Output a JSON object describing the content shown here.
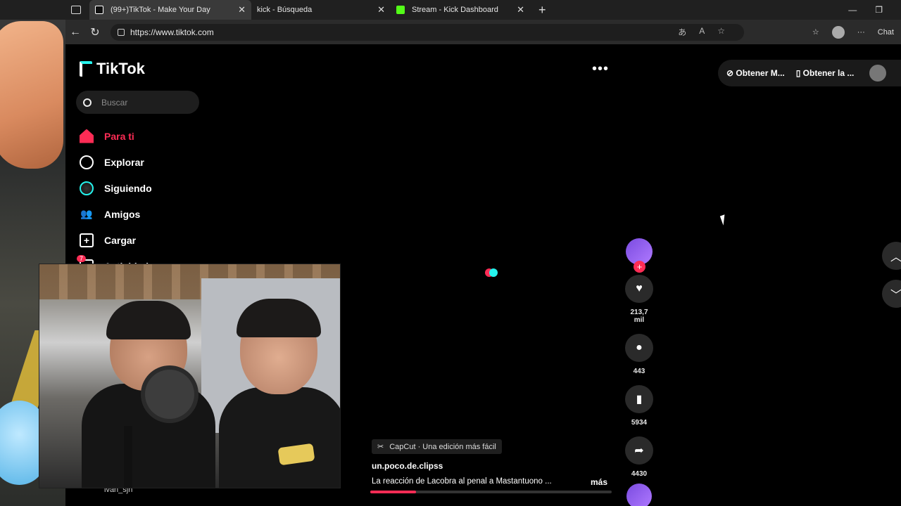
{
  "browser": {
    "tabs": [
      {
        "label": "(99+)TikTok - Make Your Day",
        "active": true,
        "favicon": "tiktok-icon"
      },
      {
        "label": "kick - Búsqueda",
        "active": false,
        "favicon": "search-icon"
      },
      {
        "label": "Stream - Kick Dashboard",
        "active": false,
        "favicon": "kick-icon"
      }
    ],
    "tab_close": "✕",
    "new_tab": "+",
    "url": "https://www.tiktok.com",
    "chat_label": "Chat",
    "minimize": "—",
    "restore": "❐"
  },
  "tiktok": {
    "logo_text": "TikTok",
    "search_placeholder": "Buscar",
    "nav": [
      {
        "label": "Para ti",
        "icon": "home-icon",
        "active": true
      },
      {
        "label": "Explorar",
        "icon": "compass-icon",
        "active": false
      },
      {
        "label": "Siguiendo",
        "icon": "following-avatar-icon",
        "active": false
      },
      {
        "label": "Amigos",
        "icon": "friends-icon",
        "active": false
      },
      {
        "label": "Cargar",
        "icon": "upload-icon",
        "active": false
      },
      {
        "label": "Actividad",
        "icon": "activity-icon",
        "active": false
      }
    ],
    "activity_badge": "7",
    "more_dots": "•••",
    "get_app_1": "Obtener M...",
    "get_app_2": "Obtener la ...",
    "actions": {
      "like_count": "213,7 mil",
      "comment_count": "443",
      "save_count": "5934",
      "share_count": "4430"
    },
    "caption": {
      "capcut": "CapCut · Una edición más fácil",
      "username": "un.poco.de.clipss",
      "description": "La reacción de Lacobra al penal a Mastantuono ...",
      "more": "más"
    },
    "progress_fraction": 0.19,
    "bottom_user": "ivan_sjn"
  },
  "colors": {
    "accent": "#fe2c55",
    "cyan": "#25f4ee",
    "kick_green": "#53fc18"
  }
}
